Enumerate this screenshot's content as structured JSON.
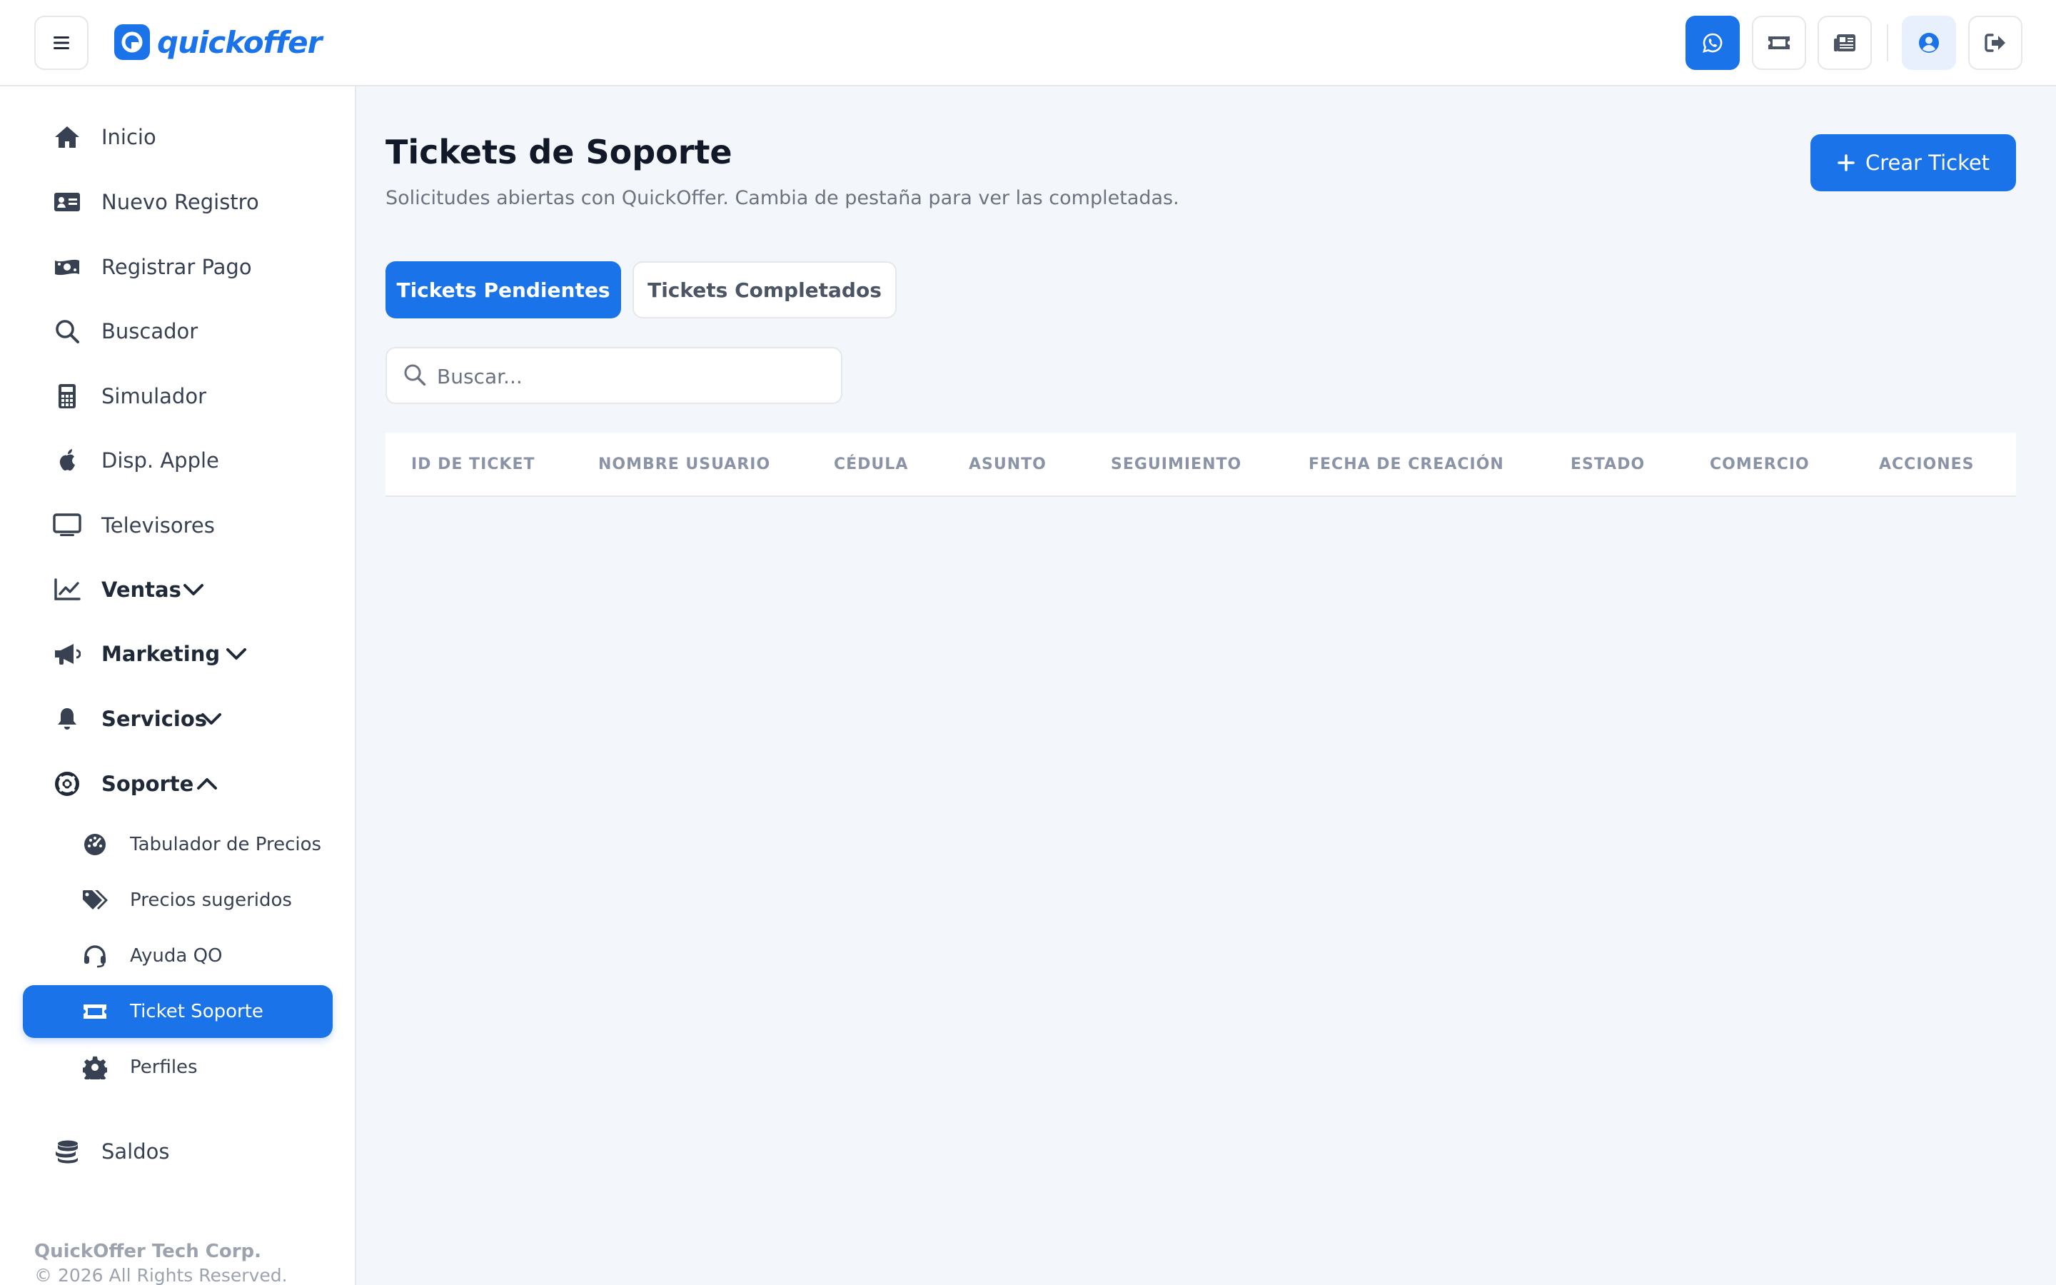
{
  "brand": {
    "name": "quickoffer",
    "color": "#1a73e8"
  },
  "header": {
    "icons": [
      "whatsapp-icon",
      "ticket-icon",
      "newspaper-icon",
      "user-circle-icon",
      "sign-out-icon"
    ]
  },
  "sidebar": {
    "items": [
      {
        "label": "Inicio",
        "icon": "home-icon"
      },
      {
        "label": "Nuevo Registro",
        "icon": "id-card-icon"
      },
      {
        "label": "Registrar Pago",
        "icon": "money-bill-icon"
      },
      {
        "label": "Buscador",
        "icon": "search-icon"
      },
      {
        "label": "Simulador",
        "icon": "calculator-icon"
      },
      {
        "label": "Disp. Apple",
        "icon": "apple-icon"
      },
      {
        "label": "Televisores",
        "icon": "tv-icon"
      },
      {
        "label": "Ventas",
        "icon": "chart-line-icon",
        "expandable": true
      },
      {
        "label": "Marketing",
        "icon": "megaphone-icon",
        "expandable": true
      },
      {
        "label": "Servicios",
        "icon": "bell-icon",
        "expandable": true
      },
      {
        "label": "Soporte",
        "icon": "lifebuoy-icon",
        "expanded": true
      }
    ],
    "support_sub": [
      {
        "label": "Tabulador de Precios",
        "icon": "gauge-icon"
      },
      {
        "label": "Precios sugeridos",
        "icon": "tags-icon"
      },
      {
        "label": "Ayuda QO",
        "icon": "headset-icon"
      },
      {
        "label": "Ticket Soporte",
        "icon": "ticket-icon",
        "active": true
      },
      {
        "label": "Perfiles",
        "icon": "gear-icon"
      }
    ],
    "saldos": {
      "label": "Saldos",
      "icon": "coins-icon"
    },
    "footer": {
      "company": "QuickOffer Tech Corp.",
      "copyright": "© 2026 All Rights Reserved."
    }
  },
  "main": {
    "title": "Tickets de Soporte",
    "subtitle": "Solicitudes abiertas con QuickOffer. Cambia de pestaña para ver las completadas.",
    "create_button": "Crear Ticket",
    "tabs": [
      {
        "label": "Tickets Pendientes",
        "active": true
      },
      {
        "label": "Tickets Completados",
        "active": false
      }
    ],
    "search": {
      "placeholder": "Buscar...",
      "value": ""
    },
    "table": {
      "columns": [
        "ID DE TICKET",
        "NOMBRE USUARIO",
        "CÉDULA",
        "ASUNTO",
        "SEGUIMIENTO",
        "FECHA DE CREACIÓN",
        "ESTADO",
        "COMERCIO",
        "ACCIONES"
      ],
      "rows": []
    }
  }
}
